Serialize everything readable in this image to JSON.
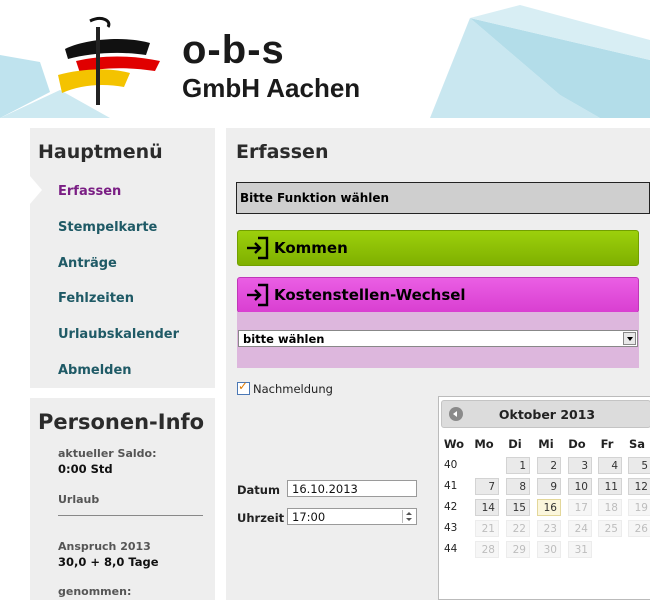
{
  "header": {
    "brand_line1": "o-b-s",
    "brand_line2": "GmbH Aachen"
  },
  "sidebar": {
    "title": "Hauptmenü",
    "items": [
      {
        "label": "Erfassen",
        "active": true
      },
      {
        "label": "Stempelkarte"
      },
      {
        "label": "Anträge"
      },
      {
        "label": "Fehlzeiten"
      },
      {
        "label": "Urlaubskalender"
      },
      {
        "label": "Abmelden"
      }
    ]
  },
  "person": {
    "title": "Personen-Info",
    "saldo_label": "aktueller Saldo:",
    "saldo_value": "0:00 Std",
    "urlaub_label": "Urlaub",
    "anspruch_label": "Anspruch 2013",
    "anspruch_value": "30,0 + 8,0 Tage",
    "genommen_label": "genommen:"
  },
  "main": {
    "title": "Erfassen",
    "function_prompt": "Bitte Funktion wählen",
    "btn_kommen": "Kommen",
    "btn_kst": "Kostenstellen-Wechsel",
    "select_value": "bitte wählen",
    "nachmeldung_label": "Nachmeldung",
    "nachmeldung_checked": true,
    "datum_label": "Datum",
    "datum_value": "16.10.2013",
    "uhrzeit_label": "Uhrzeit",
    "uhrzeit_value": "17:00"
  },
  "calendar": {
    "title": "Oktober 2013",
    "weekday_header": [
      "Wo",
      "Mo",
      "Di",
      "Mi",
      "Do",
      "Fr",
      "Sa"
    ],
    "weeks": [
      "40",
      "41",
      "42",
      "43",
      "44"
    ],
    "rows": [
      [
        "",
        "1",
        "2",
        "3",
        "4",
        "5"
      ],
      [
        "7",
        "8",
        "9",
        "10",
        "11",
        "12"
      ],
      [
        "14",
        "15",
        "16",
        "17",
        "18",
        "19"
      ],
      [
        "21",
        "22",
        "23",
        "24",
        "25",
        "26"
      ],
      [
        "28",
        "29",
        "30",
        "31",
        "",
        ""
      ]
    ],
    "today": "16"
  },
  "colors": {
    "kommen": "#8dc000",
    "kst": "#e04bd8",
    "kst_area": "#ddb7dd",
    "menu_active": "#7a1e84",
    "menu": "#1f5a66"
  }
}
